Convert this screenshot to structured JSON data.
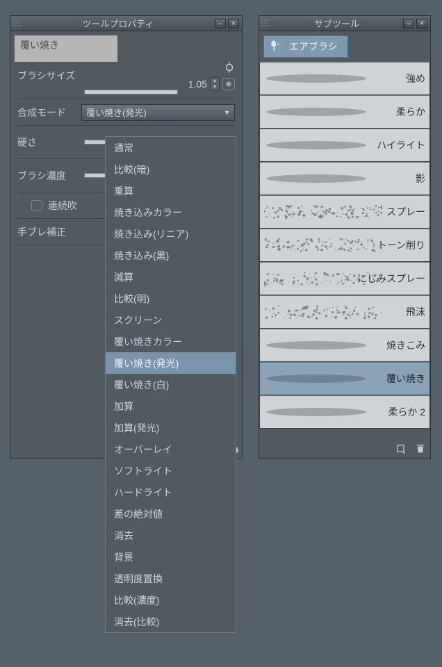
{
  "left_panel": {
    "title": "ツールプロパティ",
    "chip_label": "覆い焼き",
    "brush_size": {
      "label": "ブラシサイズ",
      "value": "1.05"
    },
    "blend_mode": {
      "label": "合成モード",
      "selected": "覆い焼き(発光)"
    },
    "hardness": {
      "label": "硬さ"
    },
    "density": {
      "label": "ブラシ濃度"
    },
    "continuous": {
      "label": "連続吹"
    },
    "stabilize": {
      "label": "手ブレ補正"
    }
  },
  "blend_modes": [
    "通常",
    "比較(暗)",
    "乗算",
    "焼き込みカラー",
    "焼き込み(リニア)",
    "焼き込み(黒)",
    "減算",
    "比較(明)",
    "スクリーン",
    "覆い焼きカラー",
    "覆い焼き(発光)",
    "覆い焼き(白)",
    "加算",
    "加算(発光)",
    "オーバーレイ",
    "ソフトライト",
    "ハードライト",
    "差の絶対値",
    "消去",
    "背景",
    "透明度置換",
    "比較(濃度)",
    "消去(比較)"
  ],
  "blend_selected_index": 10,
  "right_panel": {
    "title": "サブツール",
    "category": "エアブラシ",
    "brushes": [
      {
        "name": "強め",
        "spray": false
      },
      {
        "name": "柔らか",
        "spray": false
      },
      {
        "name": "ハイライト",
        "spray": false
      },
      {
        "name": "影",
        "spray": false
      },
      {
        "name": "スプレー",
        "spray": true
      },
      {
        "name": "トーン削り",
        "spray": true
      },
      {
        "name": "にじみスプレー",
        "spray": true
      },
      {
        "name": "飛沫",
        "spray": true
      },
      {
        "name": "焼きこみ",
        "spray": false
      },
      {
        "name": "覆い焼き",
        "spray": false
      },
      {
        "name": "柔らか 2",
        "spray": false
      }
    ],
    "selected_index": 9
  }
}
